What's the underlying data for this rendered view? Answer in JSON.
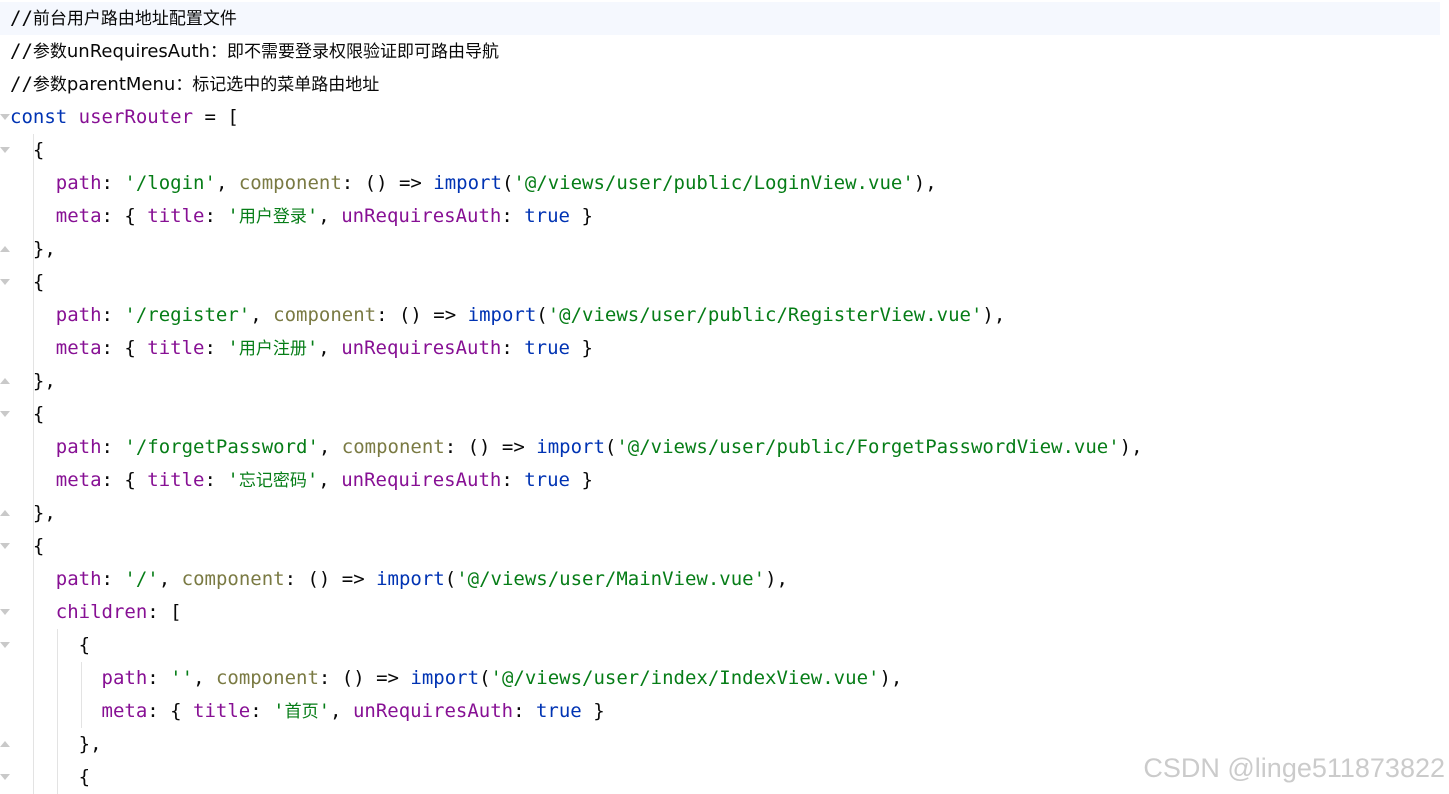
{
  "editor": {
    "lines": [
      {
        "segments": [
          {
            "t": "//",
            "c": "cmt-slash"
          },
          {
            "t": "前台用户路由地址配置文件",
            "c": "cmt-cn"
          }
        ],
        "current": true
      },
      {
        "segments": [
          {
            "t": "//",
            "c": "cmt-slash"
          },
          {
            "t": "参数",
            "c": "cmt-cn"
          },
          {
            "t": "unRequiresAuth",
            "c": "cmt-sans"
          },
          {
            "t": "：即不需要登录权限验证即可路由导航",
            "c": "cmt-cn"
          }
        ]
      },
      {
        "segments": [
          {
            "t": "//",
            "c": "cmt-slash"
          },
          {
            "t": "参数",
            "c": "cmt-cn"
          },
          {
            "t": "parentMenu",
            "c": "cmt-sans"
          },
          {
            "t": "：标记选中的菜单路由地址",
            "c": "cmt-cn"
          }
        ]
      },
      {
        "segments": [
          {
            "t": "const",
            "c": "kw"
          },
          {
            "t": " ",
            "c": "punct"
          },
          {
            "t": "userRouter",
            "c": "ident"
          },
          {
            "t": " = [",
            "c": "punct"
          }
        ]
      },
      {
        "segments": [
          {
            "t": "  {",
            "c": "punct"
          }
        ],
        "guides": [
          1
        ]
      },
      {
        "segments": [
          {
            "t": "    ",
            "c": "punct"
          },
          {
            "t": "path",
            "c": "prop"
          },
          {
            "t": ": ",
            "c": "punct"
          },
          {
            "t": "'/login'",
            "c": "str"
          },
          {
            "t": ", ",
            "c": "punct"
          },
          {
            "t": "component",
            "c": "prop-olive"
          },
          {
            "t": ": () => ",
            "c": "punct"
          },
          {
            "t": "import",
            "c": "kw"
          },
          {
            "t": "(",
            "c": "punct"
          },
          {
            "t": "'@/views/user/public/LoginView.vue'",
            "c": "str"
          },
          {
            "t": "),",
            "c": "punct"
          }
        ],
        "guides": [
          1
        ]
      },
      {
        "segments": [
          {
            "t": "    ",
            "c": "punct"
          },
          {
            "t": "meta",
            "c": "prop"
          },
          {
            "t": ": { ",
            "c": "punct"
          },
          {
            "t": "title",
            "c": "prop"
          },
          {
            "t": ": ",
            "c": "punct"
          },
          {
            "t": "'",
            "c": "str"
          },
          {
            "t": "用户登录",
            "c": "str-cn"
          },
          {
            "t": "'",
            "c": "str"
          },
          {
            "t": ", ",
            "c": "punct"
          },
          {
            "t": "unRequiresAuth",
            "c": "prop"
          },
          {
            "t": ": ",
            "c": "punct"
          },
          {
            "t": "true",
            "c": "kw"
          },
          {
            "t": " }",
            "c": "punct"
          }
        ],
        "guides": [
          1
        ]
      },
      {
        "segments": [
          {
            "t": "  },",
            "c": "punct"
          }
        ],
        "guides": [
          1
        ]
      },
      {
        "segments": [
          {
            "t": "  {",
            "c": "punct"
          }
        ],
        "guides": [
          1
        ]
      },
      {
        "segments": [
          {
            "t": "    ",
            "c": "punct"
          },
          {
            "t": "path",
            "c": "prop"
          },
          {
            "t": ": ",
            "c": "punct"
          },
          {
            "t": "'/register'",
            "c": "str"
          },
          {
            "t": ", ",
            "c": "punct"
          },
          {
            "t": "component",
            "c": "prop-olive"
          },
          {
            "t": ": () => ",
            "c": "punct"
          },
          {
            "t": "import",
            "c": "kw"
          },
          {
            "t": "(",
            "c": "punct"
          },
          {
            "t": "'@/views/user/public/RegisterView.vue'",
            "c": "str"
          },
          {
            "t": "),",
            "c": "punct"
          }
        ],
        "guides": [
          1
        ]
      },
      {
        "segments": [
          {
            "t": "    ",
            "c": "punct"
          },
          {
            "t": "meta",
            "c": "prop"
          },
          {
            "t": ": { ",
            "c": "punct"
          },
          {
            "t": "title",
            "c": "prop"
          },
          {
            "t": ": ",
            "c": "punct"
          },
          {
            "t": "'",
            "c": "str"
          },
          {
            "t": "用户注册",
            "c": "str-cn"
          },
          {
            "t": "'",
            "c": "str"
          },
          {
            "t": ", ",
            "c": "punct"
          },
          {
            "t": "unRequiresAuth",
            "c": "prop"
          },
          {
            "t": ": ",
            "c": "punct"
          },
          {
            "t": "true",
            "c": "kw"
          },
          {
            "t": " }",
            "c": "punct"
          }
        ],
        "guides": [
          1
        ]
      },
      {
        "segments": [
          {
            "t": "  },",
            "c": "punct"
          }
        ],
        "guides": [
          1
        ]
      },
      {
        "segments": [
          {
            "t": "  {",
            "c": "punct"
          }
        ],
        "guides": [
          1
        ]
      },
      {
        "segments": [
          {
            "t": "    ",
            "c": "punct"
          },
          {
            "t": "path",
            "c": "prop"
          },
          {
            "t": ": ",
            "c": "punct"
          },
          {
            "t": "'/forgetPassword'",
            "c": "str"
          },
          {
            "t": ", ",
            "c": "punct"
          },
          {
            "t": "component",
            "c": "prop-olive"
          },
          {
            "t": ": () => ",
            "c": "punct"
          },
          {
            "t": "import",
            "c": "kw"
          },
          {
            "t": "(",
            "c": "punct"
          },
          {
            "t": "'@/views/user/public/ForgetPasswordView.vue'",
            "c": "str"
          },
          {
            "t": "),",
            "c": "punct"
          }
        ],
        "guides": [
          1
        ]
      },
      {
        "segments": [
          {
            "t": "    ",
            "c": "punct"
          },
          {
            "t": "meta",
            "c": "prop"
          },
          {
            "t": ": { ",
            "c": "punct"
          },
          {
            "t": "title",
            "c": "prop"
          },
          {
            "t": ": ",
            "c": "punct"
          },
          {
            "t": "'",
            "c": "str"
          },
          {
            "t": "忘记密码",
            "c": "str-cn"
          },
          {
            "t": "'",
            "c": "str"
          },
          {
            "t": ", ",
            "c": "punct"
          },
          {
            "t": "unRequiresAuth",
            "c": "prop"
          },
          {
            "t": ": ",
            "c": "punct"
          },
          {
            "t": "true",
            "c": "kw"
          },
          {
            "t": " }",
            "c": "punct"
          }
        ],
        "guides": [
          1
        ]
      },
      {
        "segments": [
          {
            "t": "  },",
            "c": "punct"
          }
        ],
        "guides": [
          1
        ]
      },
      {
        "segments": [
          {
            "t": "  {",
            "c": "punct"
          }
        ],
        "guides": [
          1
        ]
      },
      {
        "segments": [
          {
            "t": "    ",
            "c": "punct"
          },
          {
            "t": "path",
            "c": "prop"
          },
          {
            "t": ": ",
            "c": "punct"
          },
          {
            "t": "'/'",
            "c": "str"
          },
          {
            "t": ", ",
            "c": "punct"
          },
          {
            "t": "component",
            "c": "prop-olive"
          },
          {
            "t": ": () => ",
            "c": "punct"
          },
          {
            "t": "import",
            "c": "kw"
          },
          {
            "t": "(",
            "c": "punct"
          },
          {
            "t": "'@/views/user/MainView.vue'",
            "c": "str"
          },
          {
            "t": "),",
            "c": "punct"
          }
        ],
        "guides": [
          1
        ]
      },
      {
        "segments": [
          {
            "t": "    ",
            "c": "punct"
          },
          {
            "t": "children",
            "c": "prop"
          },
          {
            "t": ": [",
            "c": "punct"
          }
        ],
        "guides": [
          1
        ]
      },
      {
        "segments": [
          {
            "t": "      {",
            "c": "punct"
          }
        ],
        "guides": [
          1,
          2
        ]
      },
      {
        "segments": [
          {
            "t": "        ",
            "c": "punct"
          },
          {
            "t": "path",
            "c": "prop"
          },
          {
            "t": ": ",
            "c": "punct"
          },
          {
            "t": "''",
            "c": "str"
          },
          {
            "t": ", ",
            "c": "punct"
          },
          {
            "t": "component",
            "c": "prop-olive"
          },
          {
            "t": ": () => ",
            "c": "punct"
          },
          {
            "t": "import",
            "c": "kw"
          },
          {
            "t": "(",
            "c": "punct"
          },
          {
            "t": "'@/views/user/index/IndexView.vue'",
            "c": "str"
          },
          {
            "t": "),",
            "c": "punct"
          }
        ],
        "guides": [
          1,
          2,
          3
        ]
      },
      {
        "segments": [
          {
            "t": "        ",
            "c": "punct"
          },
          {
            "t": "meta",
            "c": "prop"
          },
          {
            "t": ": { ",
            "c": "punct"
          },
          {
            "t": "title",
            "c": "prop"
          },
          {
            "t": ": ",
            "c": "punct"
          },
          {
            "t": "'",
            "c": "str"
          },
          {
            "t": "首页",
            "c": "str-cn"
          },
          {
            "t": "'",
            "c": "str"
          },
          {
            "t": ", ",
            "c": "punct"
          },
          {
            "t": "unRequiresAuth",
            "c": "prop"
          },
          {
            "t": ": ",
            "c": "punct"
          },
          {
            "t": "true",
            "c": "kw"
          },
          {
            "t": " }",
            "c": "punct"
          }
        ],
        "guides": [
          1,
          2,
          3
        ]
      },
      {
        "segments": [
          {
            "t": "      },",
            "c": "punct"
          }
        ],
        "guides": [
          1,
          2
        ]
      },
      {
        "segments": [
          {
            "t": "      {",
            "c": "punct"
          }
        ],
        "guides": [
          1,
          2
        ]
      }
    ],
    "fold_markers": [
      {
        "line": 0,
        "kind": "close"
      },
      {
        "line": 3,
        "kind": "open"
      },
      {
        "line": 4,
        "kind": "open"
      },
      {
        "line": 7,
        "kind": "close"
      },
      {
        "line": 8,
        "kind": "open"
      },
      {
        "line": 11,
        "kind": "close"
      },
      {
        "line": 12,
        "kind": "open"
      },
      {
        "line": 15,
        "kind": "close"
      },
      {
        "line": 16,
        "kind": "open"
      },
      {
        "line": 18,
        "kind": "open"
      },
      {
        "line": 19,
        "kind": "open"
      },
      {
        "line": 22,
        "kind": "close"
      },
      {
        "line": 23,
        "kind": "open"
      }
    ]
  },
  "watermark": "CSDN @linge511873822"
}
